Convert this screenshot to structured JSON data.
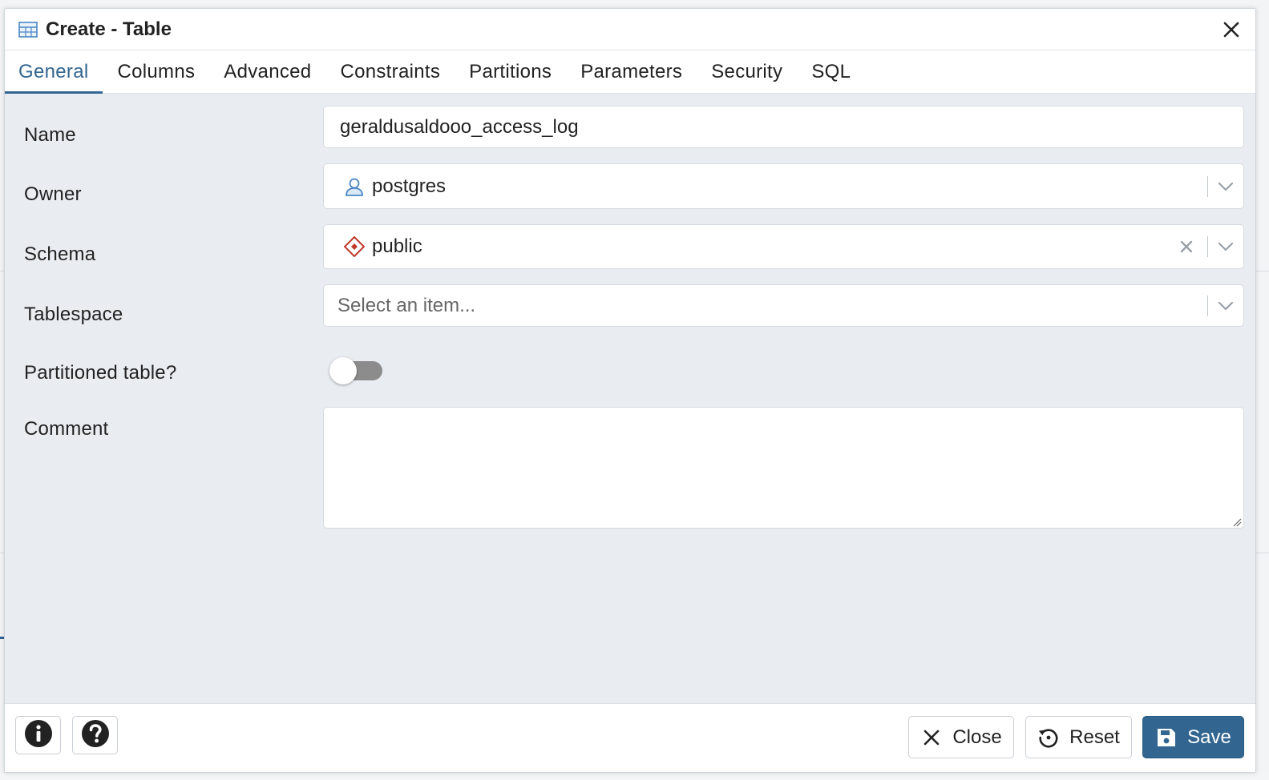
{
  "dialog": {
    "title": "Create - Table"
  },
  "tabs": [
    {
      "label": "General"
    },
    {
      "label": "Columns"
    },
    {
      "label": "Advanced"
    },
    {
      "label": "Constraints"
    },
    {
      "label": "Partitions"
    },
    {
      "label": "Parameters"
    },
    {
      "label": "Security"
    },
    {
      "label": "SQL"
    }
  ],
  "form": {
    "name": {
      "label": "Name",
      "value": "geraldusaldooo_access_log"
    },
    "owner": {
      "label": "Owner",
      "value": "postgres",
      "icon": "user-icon"
    },
    "schema": {
      "label": "Schema",
      "value": "public",
      "icon": "schema-diamond-icon"
    },
    "tablespace": {
      "label": "Tablespace",
      "placeholder": "Select an item..."
    },
    "partitioned": {
      "label": "Partitioned table?",
      "value": false
    },
    "comment": {
      "label": "Comment",
      "value": ""
    }
  },
  "footer": {
    "close_label": "Close",
    "reset_label": "Reset",
    "save_label": "Save"
  },
  "colors": {
    "accent": "#326690",
    "schema_icon": "#c0392b",
    "owner_icon": "#4a86c5"
  }
}
